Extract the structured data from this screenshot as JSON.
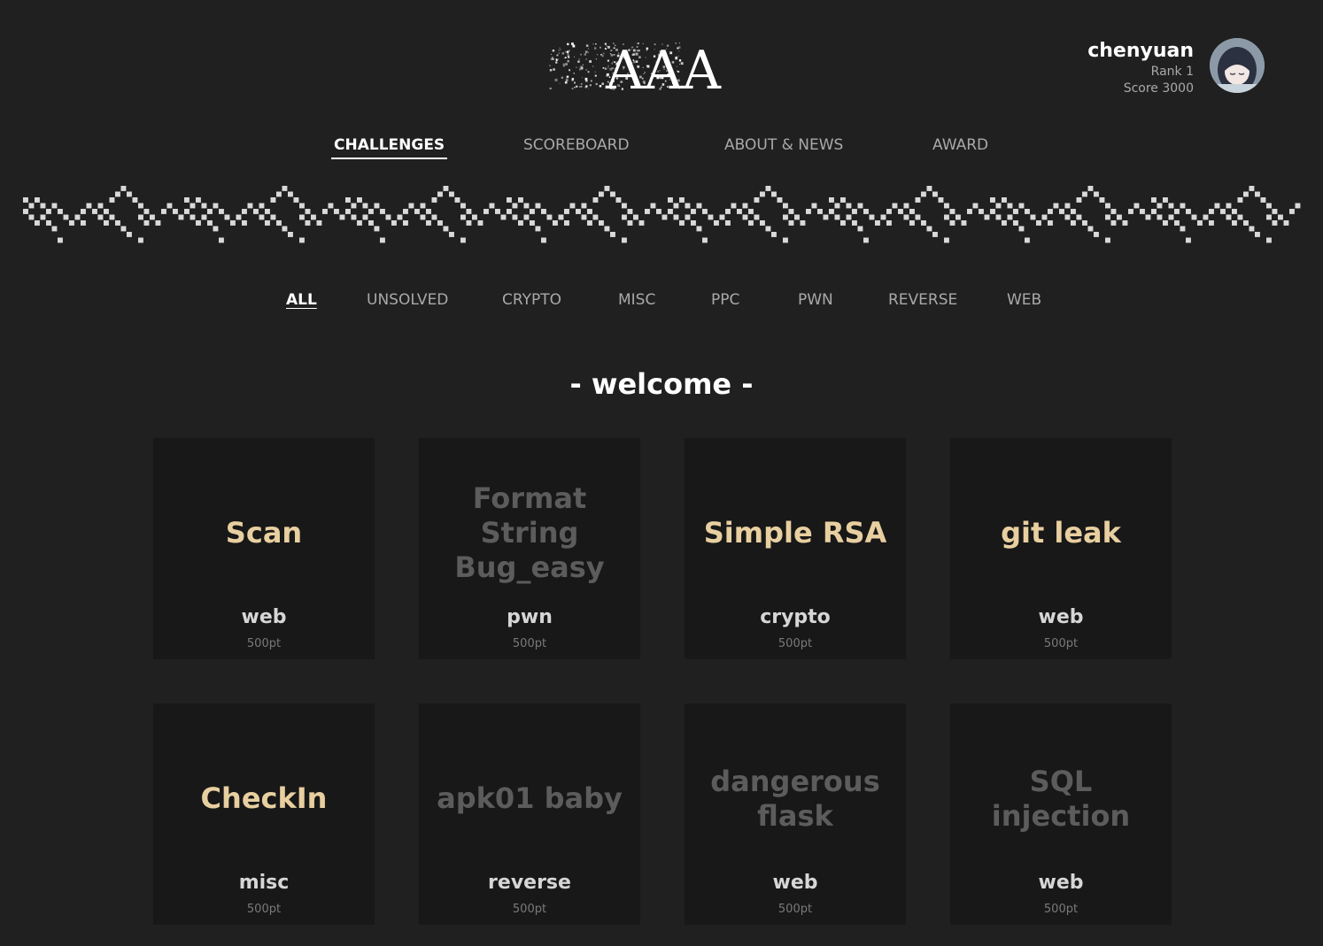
{
  "header": {
    "logo_text": "AAA"
  },
  "user": {
    "name": "chenyuan",
    "rank": "Rank 1",
    "score": "Score 3000",
    "avatar_icon": "anime-girl-avatar"
  },
  "nav": {
    "items": [
      {
        "label": "CHALLENGES",
        "active": true
      },
      {
        "label": "SCOREBOARD",
        "active": false
      },
      {
        "label": "ABOUT & NEWS",
        "active": false
      },
      {
        "label": "AWARD",
        "active": false
      }
    ]
  },
  "filters": {
    "items": [
      {
        "label": "ALL",
        "active": true
      },
      {
        "label": "UNSOLVED",
        "active": false
      },
      {
        "label": "CRYPTO",
        "active": false
      },
      {
        "label": "MISC",
        "active": false
      },
      {
        "label": "PPC",
        "active": false
      },
      {
        "label": "PWN",
        "active": false
      },
      {
        "label": "REVERSE",
        "active": false
      },
      {
        "label": "WEB",
        "active": false
      }
    ]
  },
  "section": {
    "title": "- welcome -"
  },
  "challenges": [
    {
      "title": "Scan",
      "category": "web",
      "points": "500pt",
      "solved": false
    },
    {
      "title": "Format String Bug_easy",
      "category": "pwn",
      "points": "500pt",
      "solved": true
    },
    {
      "title": "Simple RSA",
      "category": "crypto",
      "points": "500pt",
      "solved": false
    },
    {
      "title": "git leak",
      "category": "web",
      "points": "500pt",
      "solved": false
    },
    {
      "title": "CheckIn",
      "category": "misc",
      "points": "500pt",
      "solved": false
    },
    {
      "title": "apk01 baby",
      "category": "reverse",
      "points": "500pt",
      "solved": true
    },
    {
      "title": "dangerous flask",
      "category": "web",
      "points": "500pt",
      "solved": true
    },
    {
      "title": "SQL injection",
      "category": "web",
      "points": "500pt",
      "solved": true
    }
  ],
  "colors": {
    "background": "#202020",
    "card": "#181818",
    "unsolved_title": "#e8cfa0",
    "solved_title": "#5c5c5c",
    "nav_inactive": "#a9a9a9"
  }
}
